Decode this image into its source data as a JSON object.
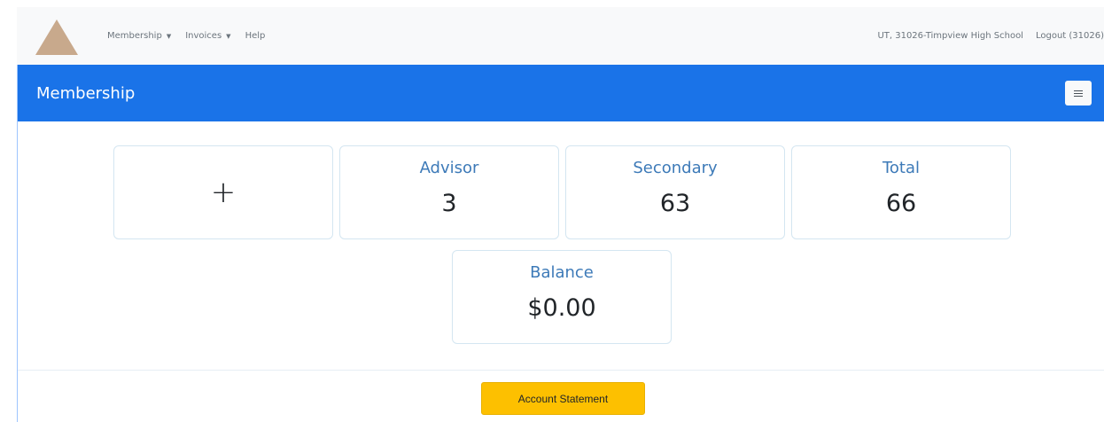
{
  "nav": {
    "logo_icon": "triangle-logo",
    "items": [
      {
        "label": "Membership",
        "has_dropdown": true
      },
      {
        "label": "Invoices",
        "has_dropdown": true
      },
      {
        "label": "Help",
        "has_dropdown": false
      }
    ],
    "org": "UT, 31026-Timpview High School",
    "logout": "Logout (31026)"
  },
  "card": {
    "title": "Membership",
    "menu_icon": "list-icon",
    "header_color": "#1a73e8"
  },
  "tiles": {
    "add": {
      "symbol": "+"
    },
    "advisor": {
      "label": "Advisor",
      "value": "3"
    },
    "secondary": {
      "label": "Secondary",
      "value": "63"
    },
    "total": {
      "label": "Total",
      "value": "66"
    },
    "balance": {
      "label": "Balance",
      "value": "$0.00"
    }
  },
  "actions": {
    "account_statement": "Account Statement",
    "button_color": "#fdc000"
  }
}
